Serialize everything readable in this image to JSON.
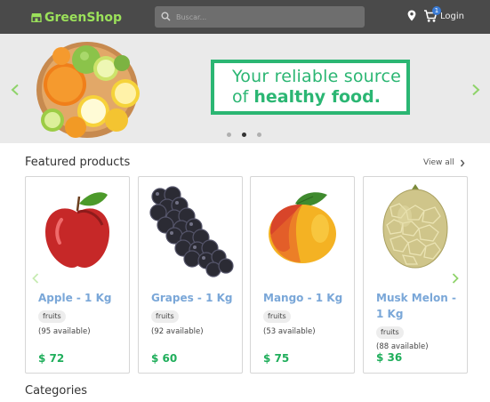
{
  "header": {
    "brand": "GreenShop",
    "search_placeholder": "Buscar...",
    "cart_count": "1",
    "login_label": "Login"
  },
  "hero": {
    "line1": "Your reliable source",
    "line2_prefix": "of ",
    "line2_bold": "healthy food.",
    "slide_count": 3,
    "active_slide": 2
  },
  "featured": {
    "title": "Featured products",
    "view_all": "View all",
    "products": [
      {
        "name": "Apple - 1 Kg",
        "category": "fruits",
        "availability": "(95 available)",
        "price": "$ 72"
      },
      {
        "name": "Grapes - 1 Kg",
        "category": "fruits",
        "availability": "(92 available)",
        "price": "$ 60"
      },
      {
        "name": "Mango - 1 Kg",
        "category": "fruits",
        "availability": "(53 available)",
        "price": "$ 75"
      },
      {
        "name": "Musk Melon - 1 Kg",
        "category": "fruits",
        "availability": "(88 available)",
        "price": "$ 36"
      }
    ]
  },
  "categories": {
    "title": "Categories"
  },
  "colors": {
    "header_bg": "#4a4a4a",
    "brand": "#9be15a",
    "accent_green": "#2bb673",
    "price_green": "#1fae5b",
    "product_name": "#7aa7d8",
    "hero_bg": "#eaeaea"
  },
  "icons": [
    "store-icon",
    "search-icon",
    "location-icon",
    "cart-icon",
    "chevron-left-icon",
    "chevron-right-icon"
  ]
}
